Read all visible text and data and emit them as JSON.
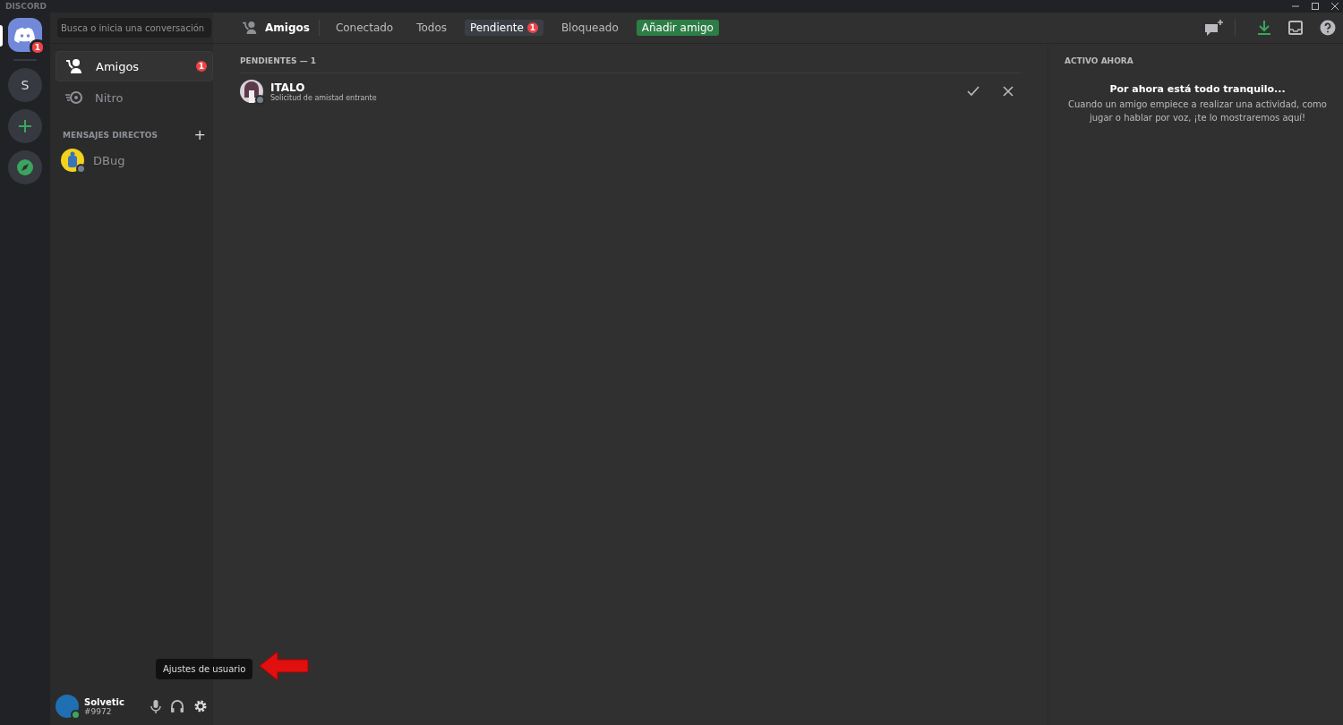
{
  "window": {
    "title": "DISCORD"
  },
  "servers": [
    {
      "kind": "home",
      "badge": "1",
      "selected": true
    },
    {
      "kind": "letter",
      "label": "S",
      "selected": false
    },
    {
      "kind": "add",
      "selected": false
    },
    {
      "kind": "explore",
      "selected": false
    }
  ],
  "search": {
    "placeholder": "Busca o inicia una conversación"
  },
  "nav_items": [
    {
      "kind": "friends",
      "label": "Amigos",
      "badge": "1",
      "selected": true
    },
    {
      "kind": "nitro",
      "label": "Nitro",
      "selected": false
    }
  ],
  "direct_messages": {
    "heading": "MENSAJES DIRECTOS",
    "add_label": "+",
    "items": [
      {
        "name": "DBug",
        "color": "#747f8d"
      }
    ]
  },
  "user_panel": {
    "name": "Solvetic",
    "tag": "#9972",
    "color": "#3ba55d",
    "tooltip": "Ajustes de usuario"
  },
  "header": {
    "title": "Amigos",
    "tabs": [
      {
        "kind": "tab",
        "label": "Conectado",
        "selected": false
      },
      {
        "kind": "tab",
        "label": "Todos",
        "selected": false
      },
      {
        "kind": "tab",
        "label": "Pendiente",
        "badge": "1",
        "selected": true
      },
      {
        "kind": "tab",
        "label": "Bloqueado",
        "selected": false
      },
      {
        "kind": "add",
        "label": "Añadir amigo",
        "selected": false
      }
    ]
  },
  "pending": {
    "heading": "PENDIENTES — 1",
    "requests": [
      {
        "name": "ITALO",
        "subtitle": "Solicitud de amistad entrante",
        "color": "#747f8d"
      }
    ]
  },
  "active_now": {
    "heading": "ACTIVO AHORA",
    "title": "Por ahora está todo tranquilo...",
    "text": "Cuando un amigo empiece a realizar una actividad, como jugar o hablar por voz, ¡te lo mostraremos aquí!"
  }
}
